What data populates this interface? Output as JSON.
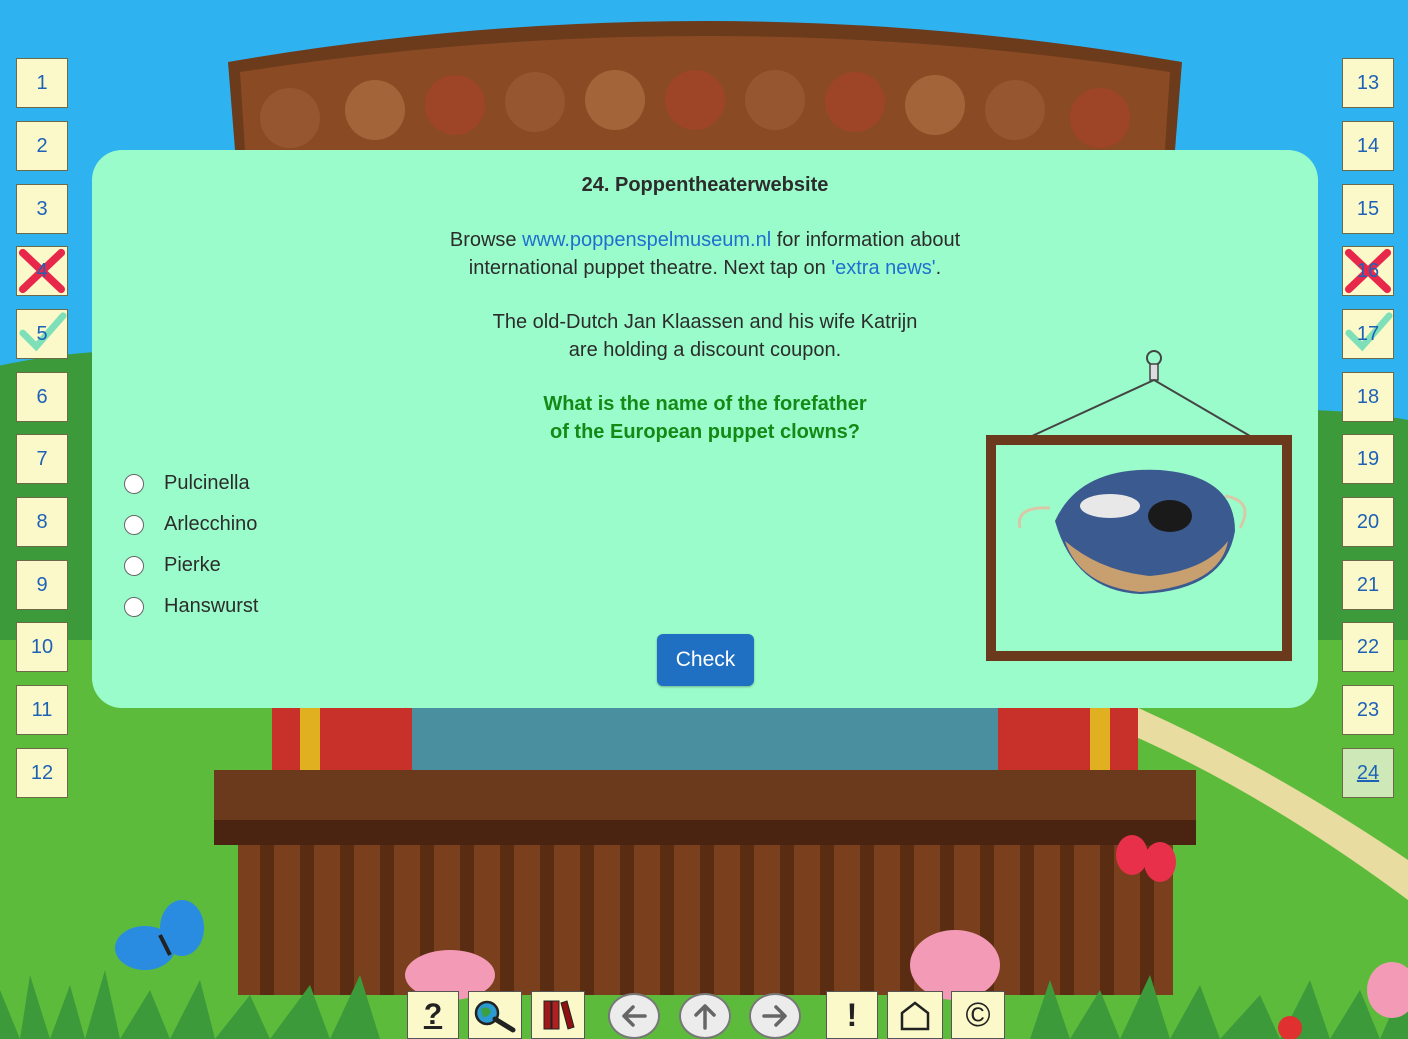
{
  "question": {
    "title": "24. Poppentheaterwebsite",
    "line1_pre": "Browse ",
    "line1_link": "www.poppenspelmuseum.nl",
    "line1_post": " for information about",
    "line2_pre": "international puppet theatre. Next tap on ",
    "line2_link": "'extra news'",
    "line2_post": ".",
    "line3": "The old-Dutch Jan Klaassen and his wife Katrijn",
    "line4": "are holding a discount coupon.",
    "prompt_line1": "What is the name of the forefather",
    "prompt_line2": "of the European puppet clowns?",
    "options": [
      "Pulcinella",
      "Arlecchino",
      "Pierke",
      "Hanswurst"
    ],
    "check_label": "Check"
  },
  "nav_left": [
    {
      "label": "1",
      "state": "normal"
    },
    {
      "label": "2",
      "state": "normal"
    },
    {
      "label": "3",
      "state": "normal"
    },
    {
      "label": "4",
      "state": "wrong"
    },
    {
      "label": "5",
      "state": "correct"
    },
    {
      "label": "6",
      "state": "normal"
    },
    {
      "label": "7",
      "state": "normal"
    },
    {
      "label": "8",
      "state": "normal"
    },
    {
      "label": "9",
      "state": "normal"
    },
    {
      "label": "10",
      "state": "normal"
    },
    {
      "label": "11",
      "state": "normal"
    },
    {
      "label": "12",
      "state": "normal"
    }
  ],
  "nav_right": [
    {
      "label": "13",
      "state": "normal"
    },
    {
      "label": "14",
      "state": "normal"
    },
    {
      "label": "15",
      "state": "normal"
    },
    {
      "label": "16",
      "state": "wrong"
    },
    {
      "label": "17",
      "state": "correct"
    },
    {
      "label": "18",
      "state": "normal"
    },
    {
      "label": "19",
      "state": "normal"
    },
    {
      "label": "20",
      "state": "normal"
    },
    {
      "label": "21",
      "state": "normal"
    },
    {
      "label": "22",
      "state": "normal"
    },
    {
      "label": "23",
      "state": "normal"
    },
    {
      "label": "24",
      "state": "current"
    }
  ],
  "toolbar": {
    "help_label": "?",
    "info_label": "!",
    "copyright_label": "©",
    "icons": [
      "help-icon",
      "search-globe-icon",
      "books-icon",
      "arrow-left-icon",
      "arrow-up-icon",
      "arrow-right-icon",
      "info-icon",
      "home-icon",
      "copyright-icon"
    ]
  },
  "colors": {
    "panel": "#9bfccb",
    "link": "#1f6fd0",
    "question": "#138a16",
    "check_button": "#1f6fc3",
    "nav_box": "#fbf9c9",
    "sky": "#2fb2f0",
    "grass": "#5dbb3c"
  }
}
